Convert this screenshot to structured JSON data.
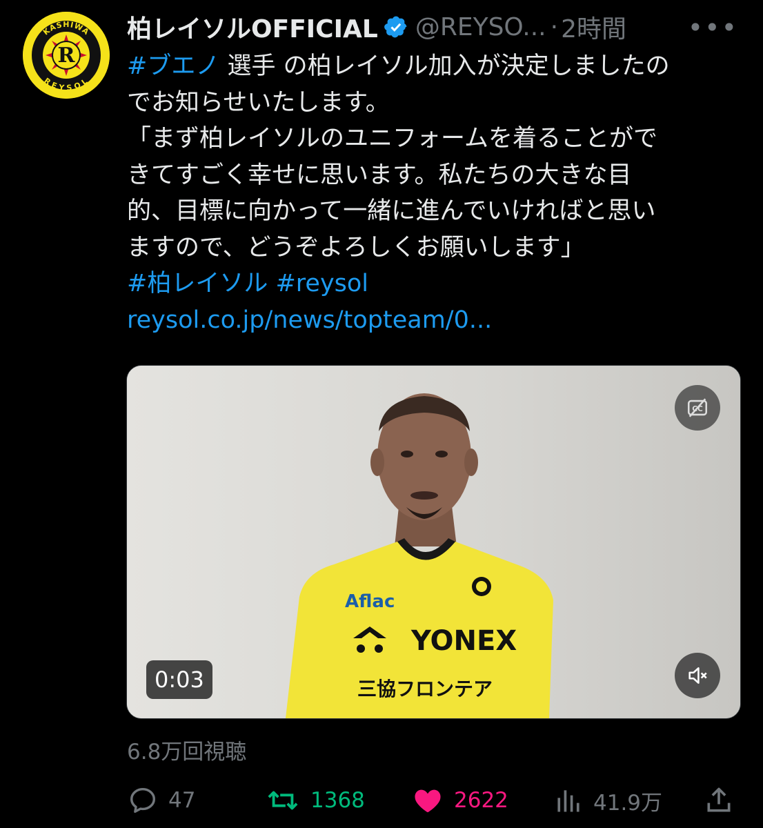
{
  "tweet": {
    "display_name": "柏レイソルOFFICIAL",
    "handle": "@REYSO...",
    "separator": "·",
    "time": "2時間",
    "more": "•••",
    "text": {
      "line1_hashtag": "#ブエノ",
      "line1_rest": " 選手 の柏レイソル加入が決定しましたの",
      "line2": "でお知らせいたします。",
      "line3": "「まず柏レイソルのユニフォームを着ることがで",
      "line4": "きてすごく幸せに思います。私たちの大きな目",
      "line5": "的、目標に向かって一緒に進んでいければと思い",
      "line6": "ますので、どうぞよろしくお願いします」",
      "hashtag1": "#柏レイソル",
      "hashtag2": "#reysol",
      "url": "reysol.co.jp/news/topteam/0..."
    },
    "video": {
      "duration": "0:03",
      "cc_icon": "closed-captions-off-icon",
      "mute_icon": "muted-speaker-icon",
      "shirt_sponsor_1": "Aflac",
      "shirt_sponsor_2": "YONEX",
      "shirt_sponsor_3": "三協フロンテア"
    },
    "views": "6.8万回視聴",
    "actions": {
      "reply_count": "47",
      "retweet_count": "1368",
      "like_count": "2622",
      "analytics_count": "41.9万"
    },
    "logo_text_top": "KASHIWA",
    "logo_text_bottom": "REYSOL"
  },
  "colors": {
    "background": "#000000",
    "text": "#e7e9ea",
    "muted": "#71767b",
    "link": "#1d9bf0",
    "retweet": "#00ba7c",
    "like": "#f91880",
    "brand_yellow": "#f5e21a"
  }
}
